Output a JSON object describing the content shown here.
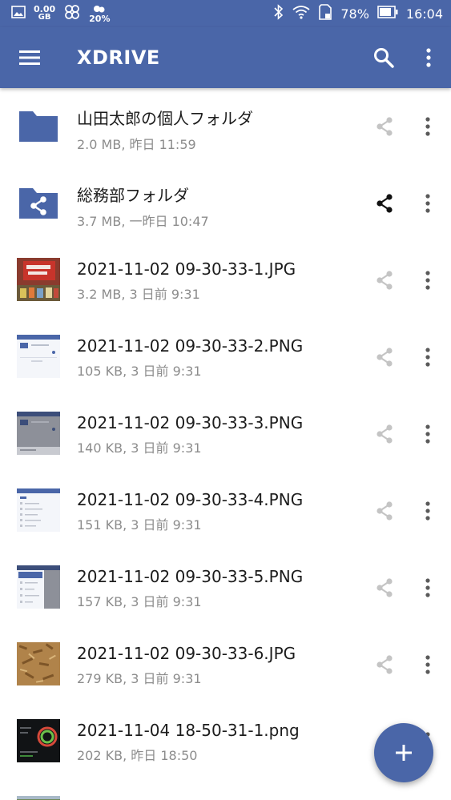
{
  "status_bar": {
    "data_speed_value": "0.00",
    "data_speed_unit": "GB",
    "weather_percent": "20%",
    "battery_percent": "78%",
    "time": "16:04"
  },
  "app_bar": {
    "title": "XDRIVE",
    "menu_icon": "hamburger-menu-icon",
    "search_icon": "search-icon",
    "more_icon": "more-vert-icon"
  },
  "files": [
    {
      "name": "山田太郎の個人フォルダ",
      "meta": "2.0 MB, 昨日 11:59",
      "kind": "folder",
      "shared": false
    },
    {
      "name": "総務部フォルダ",
      "meta": "3.7 MB, 一昨日 10:47",
      "kind": "shared-folder",
      "shared": true
    },
    {
      "name": "2021-11-02 09-30-33-1.JPG",
      "meta": "3.2 MB, 3 日前 9:31",
      "kind": "photo-red",
      "shared": false
    },
    {
      "name": "2021-11-02 09-30-33-2.PNG",
      "meta": "105 KB, 3 日前 9:31",
      "kind": "screenshot-light",
      "shared": false
    },
    {
      "name": "2021-11-02 09-30-33-3.PNG",
      "meta": "140 KB, 3 日前 9:31",
      "kind": "screenshot-dim",
      "shared": false
    },
    {
      "name": "2021-11-02 09-30-33-4.PNG",
      "meta": "151 KB, 3 日前 9:31",
      "kind": "screenshot-list",
      "shared": false
    },
    {
      "name": "2021-11-02 09-30-33-5.PNG",
      "meta": "157 KB, 3 日前 9:31",
      "kind": "screenshot-menu",
      "shared": false
    },
    {
      "name": "2021-11-02 09-30-33-6.JPG",
      "meta": "279 KB, 3 日前 9:31",
      "kind": "photo-brown",
      "shared": false
    },
    {
      "name": "2021-11-04 18-50-31-1.png",
      "meta": "202 KB, 昨日 18:50",
      "kind": "screenshot-dark",
      "shared": false
    }
  ],
  "colors": {
    "primary": "#4a66a8",
    "text_primary": "#1c1c1c",
    "text_secondary": "#8c8c8c",
    "icon_inactive": "#c4c4c4"
  }
}
